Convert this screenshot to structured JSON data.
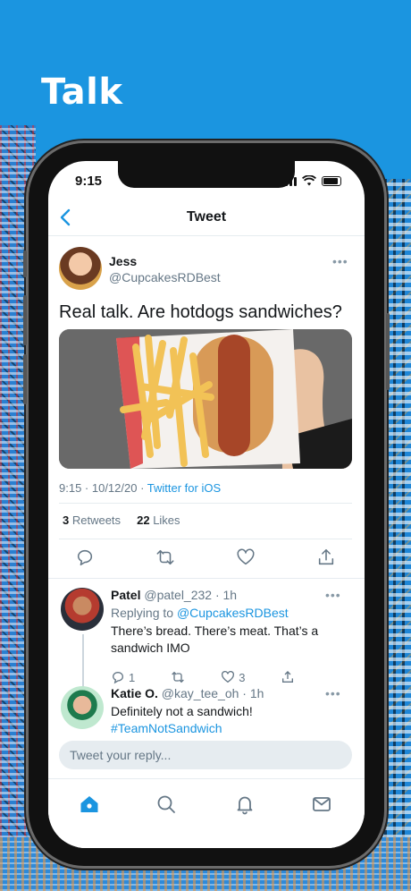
{
  "headline": "Talk",
  "status_bar": {
    "time": "9:15"
  },
  "nav": {
    "title": "Tweet"
  },
  "tweet": {
    "author_name": "Jess",
    "author_handle": "@CupcakesRDBest",
    "text": "Real talk. Are hotdogs sandwiches?",
    "timestamp": "9:15 · 10/12/20 · ",
    "source": "Twitter for iOS",
    "retweets_count": "3",
    "retweets_label": " Retweets",
    "likes_count": "22",
    "likes_label": " Likes"
  },
  "replies": [
    {
      "name": "Patel",
      "handle": "@patel_232 · 1h",
      "replying_prefix": "Replying to ",
      "replying_to": "@CupcakesRDBest",
      "text_line1": "There’s bread. There’s meat. That’s a",
      "text_line2": "sandwich IMO",
      "reply_count": "1",
      "like_count": "3"
    },
    {
      "name": "Katie O.",
      "handle": "@kay_tee_oh · 1h",
      "text_line1": "Definitely not a sandwich!",
      "hashtag": "#TeamNotSandwich"
    }
  ],
  "composer": {
    "placeholder": "Tweet your reply..."
  },
  "colors": {
    "accent": "#1b95e0",
    "text": "#14171a",
    "muted": "#657786"
  },
  "icons": {
    "tabs": [
      "home-icon",
      "search-icon",
      "notifications-icon",
      "messages-icon"
    ],
    "actions": [
      "reply-icon",
      "retweet-icon",
      "like-icon",
      "share-icon"
    ]
  }
}
